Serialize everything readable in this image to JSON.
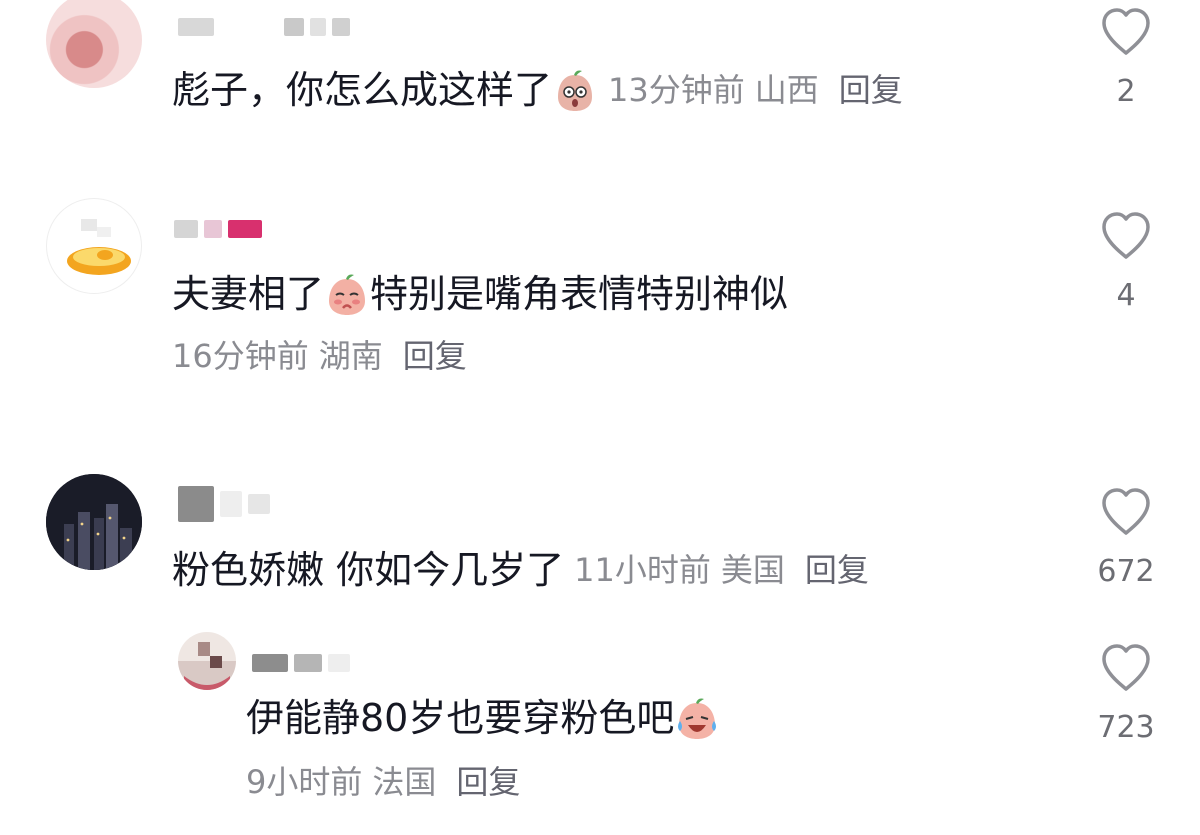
{
  "comments": [
    {
      "text": "彪子，你怎么成这样了",
      "time": "13分钟前",
      "location": "山西",
      "reply": "回复",
      "likes": "2"
    },
    {
      "text": "夫妻相了",
      "text2": "特别是嘴角表情特别神似",
      "time": "16分钟前",
      "location": "湖南",
      "reply": "回复",
      "likes": "4"
    },
    {
      "text": "粉色娇嫩 你如今几岁了",
      "time": "11小时前",
      "location": "美国",
      "reply": "回复",
      "likes": "672"
    },
    {
      "text": "伊能静80岁也要穿粉色吧",
      "time": "9小时前",
      "location": "法国",
      "reply": "回复",
      "likes": "723"
    }
  ],
  "icons": {
    "like": "heart-outline-icon",
    "emoji1": "peach-shocked-emoji",
    "emoji2": "peach-shy-emoji",
    "emoji3": "peach-laugh-cry-emoji"
  },
  "colors": {
    "text": "#161823",
    "meta": "#8a8b91",
    "heart": "#8f9096"
  }
}
